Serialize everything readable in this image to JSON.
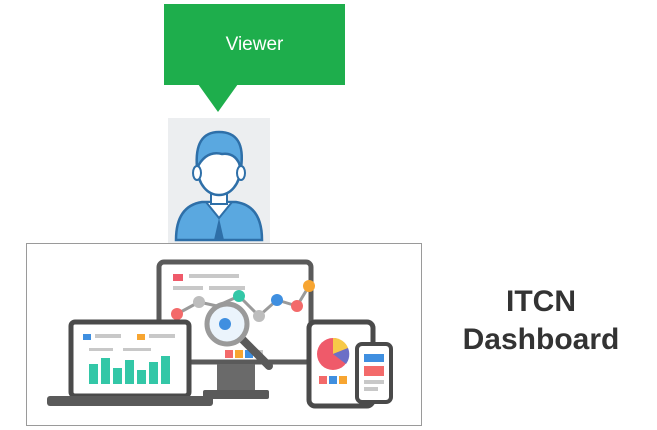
{
  "callout": {
    "label": "Viewer"
  },
  "dashboard": {
    "line1": "ITCN",
    "line2": "Dashboard"
  },
  "icons": {
    "viewer": "user-avatar-icon",
    "illustration": "devices-analytics-illustration"
  },
  "colors": {
    "callout_green": "#1eae4c",
    "avatar_blue": "#5aa8e0",
    "bars_teal": "#33c7a7",
    "label_gray": "#333333",
    "frame_gray": "#9a9a9a"
  }
}
